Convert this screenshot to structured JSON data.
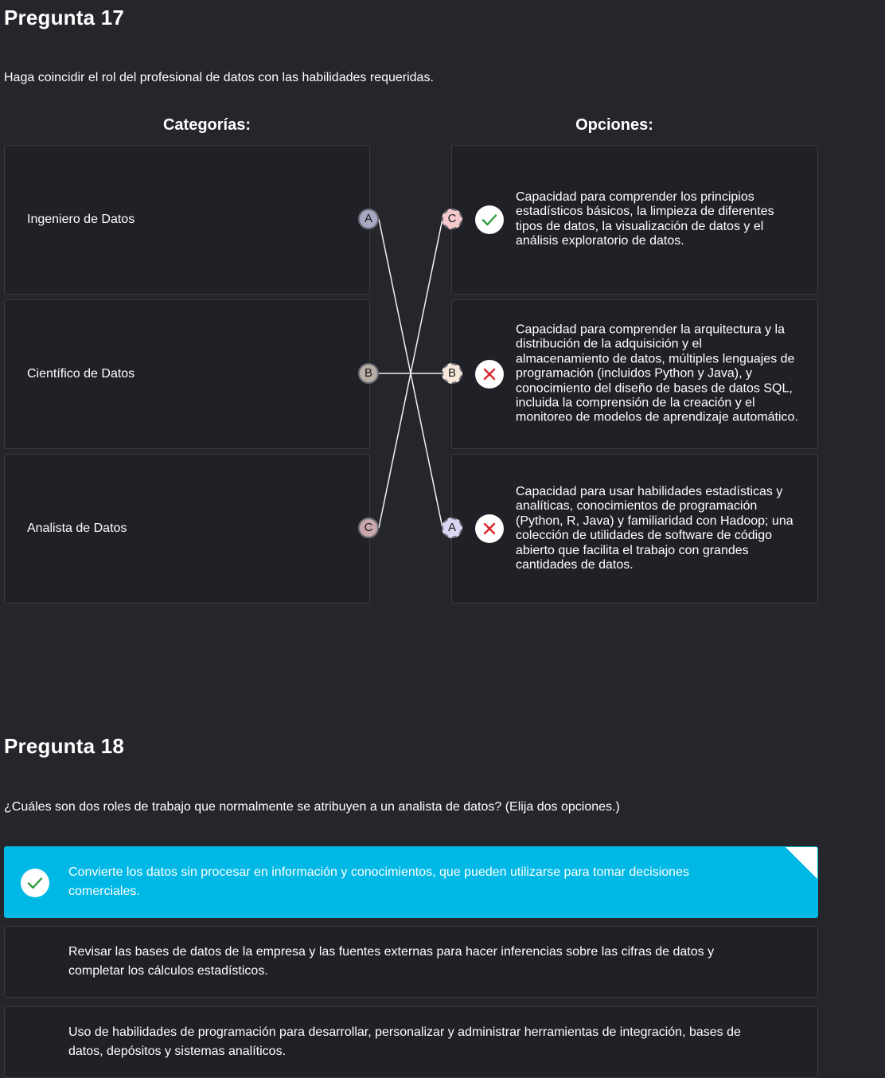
{
  "q17": {
    "title": "Pregunta 17",
    "prompt": "Haga coincidir el rol del profesional de datos con las habilidades requeridas.",
    "categories_header": "Categorías:",
    "options_header": "Opciones:",
    "categories": [
      {
        "label": "Ingeniero de Datos",
        "node": "A",
        "node_color": "#a9a8c4"
      },
      {
        "label": "Científico de Datos",
        "node": "B",
        "node_color": "#b9aea4"
      },
      {
        "label": "Analista de Datos",
        "node": "C",
        "node_color": "#c9a7ad"
      }
    ],
    "options": [
      {
        "node": "C",
        "node_color": "#f4c9cc",
        "status": "correct",
        "text": "Capacidad para comprender los principios estadísticos básicos, la limpieza de diferentes tipos de datos, la visualización de datos y el análisis exploratorio de datos."
      },
      {
        "node": "B",
        "node_color": "#f6e9dc",
        "status": "incorrect",
        "text": "Capacidad para comprender la arquitectura y la distribución de la adquisición y el almacenamiento de datos, múltiples lenguajes de programación (incluidos Python y Java), y conocimiento del diseño de bases de datos SQL, incluida la comprensión de la creación y el monitoreo de modelos de aprendizaje automático."
      },
      {
        "node": "A",
        "node_color": "#d9d6f4",
        "status": "incorrect",
        "text": "Capacidad para usar habilidades estadísticas y analíticas, conocimientos de programación (Python, R, Java) y familiaridad con Hadoop; una colección de utilidades de software de código abierto que facilita el trabajo con grandes cantidades de datos."
      }
    ],
    "connections": [
      [
        0,
        2
      ],
      [
        1,
        1
      ],
      [
        2,
        0
      ]
    ],
    "colors": {
      "correct": "#2e9e3f",
      "incorrect": "#d9262b"
    }
  },
  "q18": {
    "title": "Pregunta 18",
    "prompt": "¿Cuáles son dos roles de trabajo que normalmente se atribuyen a un analista de datos? (Elija dos opciones.)",
    "options": [
      {
        "text": "Convierte los datos sin procesar en información y conocimientos, que pueden utilizarse para tomar decisiones comerciales.",
        "selected": true
      },
      {
        "text": "Revisar las bases de datos de la empresa y las fuentes externas para hacer inferencias sobre las cifras de datos y completar los cálculos estadísticos.",
        "selected": false
      },
      {
        "text": "Uso de habilidades de programación para desarrollar, personalizar y administrar herramientas de integración, bases de datos, depósitos y sistemas analíticos.",
        "selected": false
      }
    ],
    "colors": {
      "selected_bg": "#00b8e6",
      "check": "#2e9e3f"
    }
  }
}
